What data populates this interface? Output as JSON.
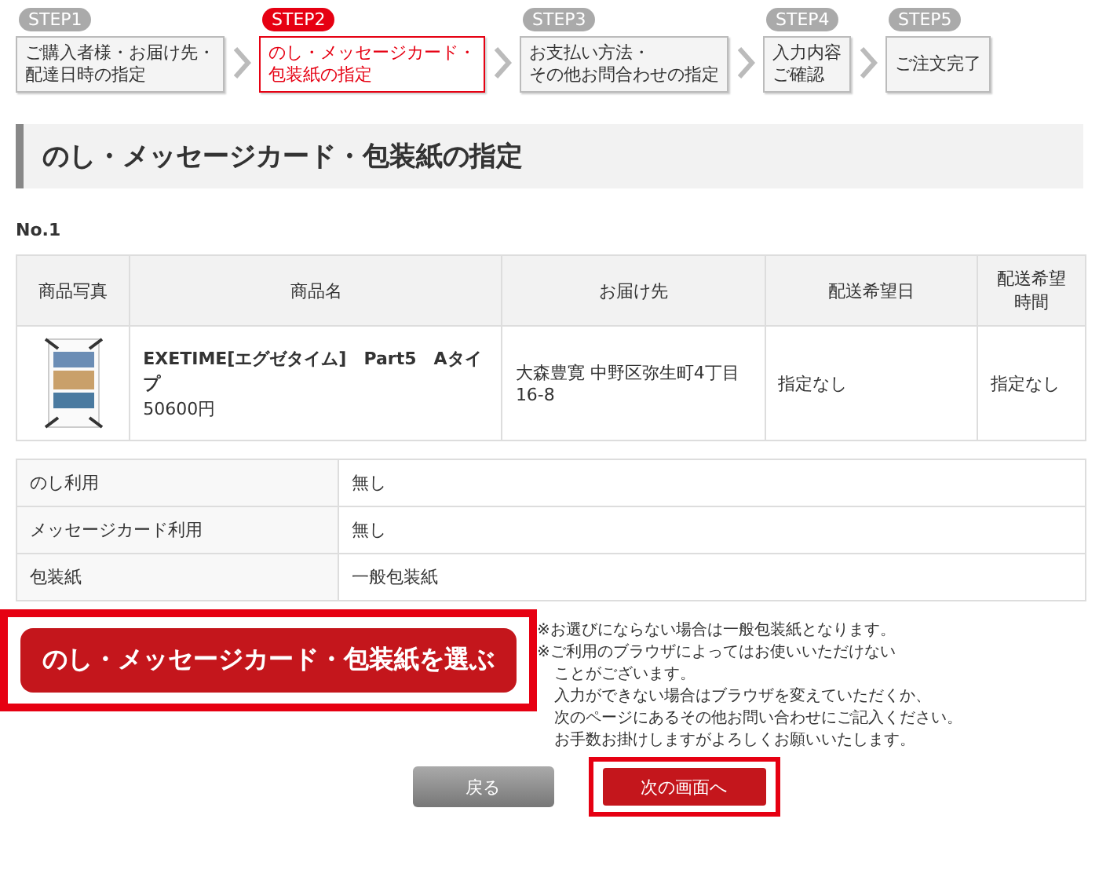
{
  "steps": [
    {
      "badge": "STEP1",
      "lines": [
        "ご購入者様・お届け先・",
        "配達日時の指定"
      ],
      "selected": false
    },
    {
      "badge": "STEP2",
      "lines": [
        "のし・メッセージカード・",
        "包装紙の指定"
      ],
      "selected": true
    },
    {
      "badge": "STEP3",
      "lines": [
        "お支払い方法・",
        "その他お問合わせの指定"
      ],
      "selected": false
    },
    {
      "badge": "STEP4",
      "lines": [
        "入力内容",
        "ご確認"
      ],
      "selected": false
    },
    {
      "badge": "STEP5",
      "lines": [
        "ご注文完了"
      ],
      "selected": false
    }
  ],
  "heading": "のし・メッセージカード・包装紙の指定",
  "order_no": "No.1",
  "table": {
    "columns": [
      [
        "商品写真"
      ],
      [
        "商品名"
      ],
      [
        "お届け先"
      ],
      [
        "配送希望日"
      ],
      [
        "配送希望",
        "時間"
      ]
    ],
    "rows": [
      {
        "kind": "picture",
        "name": "EXETIME[エグゼタイム]　Part5　Aタイプ",
        "price": "50600円",
        "address": "大森豊寛 中野区弥生町4丁目16-8",
        "date": "指定なし",
        "time": "指定なし"
      }
    ]
  },
  "options": [
    {
      "label": "のし利用",
      "value": "無し"
    },
    {
      "label": "メッセージカード利用",
      "value": "無し"
    },
    {
      "label": "包装紙",
      "value": "一般包装紙"
    }
  ],
  "select_button": {
    "label": "のし・メッセージカード・包装紙を選ぶ",
    "highlighted": true
  },
  "notes": [
    {
      "kind": "start",
      "text": "※お選びにならない場合は一般包装紙となります。"
    },
    {
      "kind": "start",
      "text": "※ご利用のブラウザによってはお使いいただけない"
    },
    {
      "kind": "continued",
      "text": "ことがございます。"
    },
    {
      "kind": "continued",
      "text": "入力ができない場合はブラウザを変えていただくか、"
    },
    {
      "kind": "continued",
      "text": "次のページにあるその他お問い合わせにご記入ください。"
    },
    {
      "kind": "continued",
      "text": "お手数お掛けしますがよろしくお願いいたします。"
    }
  ],
  "back_button": {
    "label": "戻る",
    "highlighted": false
  },
  "next_button": {
    "label": "次の画面へ",
    "highlighted": true
  }
}
